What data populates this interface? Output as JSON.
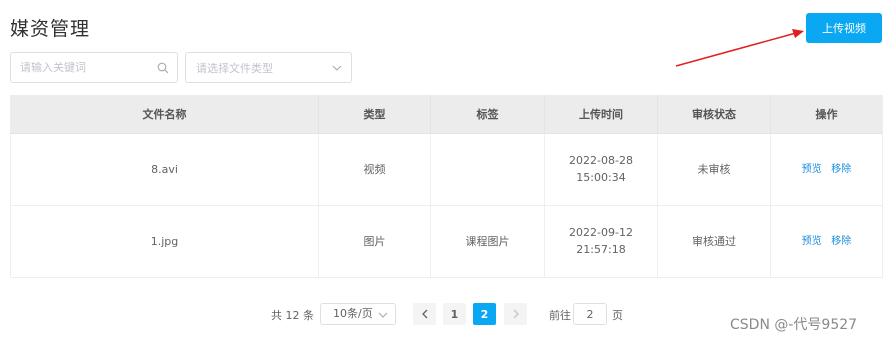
{
  "header": {
    "title": "媒资管理",
    "upload_label": "上传视频"
  },
  "filters": {
    "search_placeholder": "请输入关键词",
    "type_placeholder": "请选择文件类型"
  },
  "table": {
    "columns": [
      "文件名称",
      "类型",
      "标签",
      "上传时间",
      "审核状态",
      "操作"
    ],
    "rows": [
      {
        "name": "8.avi",
        "type": "视频",
        "tag": "",
        "time": "2022-08-28 15:00:34",
        "status": "未审核",
        "preview": "预览",
        "remove": "移除"
      },
      {
        "name": "1.jpg",
        "type": "图片",
        "tag": "课程图片",
        "time": "2022-09-12 21:57:18",
        "status": "审核通过",
        "preview": "预览",
        "remove": "移除"
      }
    ]
  },
  "pagination": {
    "total": "共 12 条",
    "page_size": "10条/页",
    "pages": [
      "1",
      "2"
    ],
    "current": "2",
    "goto_label": "前往",
    "goto_value": "2",
    "page_unit": "页"
  },
  "watermark": "CSDN @-代号9527",
  "colors": {
    "accent": "#0aa7f3",
    "arrow": "#e02020"
  }
}
